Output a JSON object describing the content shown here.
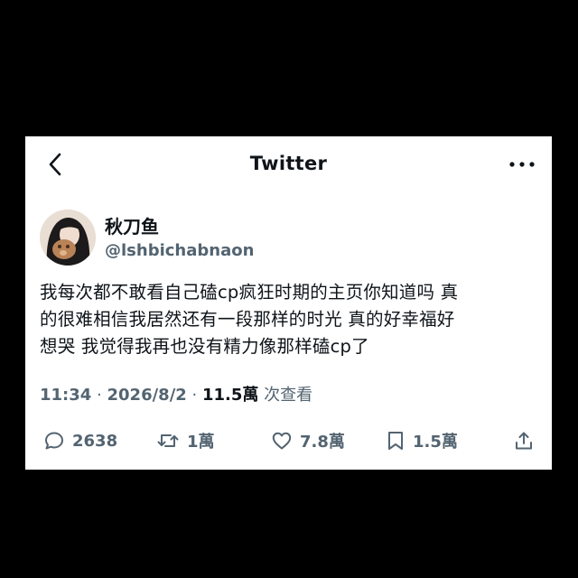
{
  "header": {
    "title": "Twitter"
  },
  "author": {
    "display_name": "秋刀鱼",
    "handle": "@lshbichabnaon"
  },
  "tweet": {
    "lines": [
      "我每次都不敢看自己磕cp疯狂时期的主页你知道吗 真",
      "的很难相信我居然还有一段那样的时光 真的好幸福好",
      "想哭 我觉得我再也没有精力像那样磕cp了"
    ]
  },
  "meta": {
    "time": "11:34",
    "separator": "·",
    "date": "2026/8/2",
    "views_count": "11.5萬",
    "views_label": "次查看"
  },
  "actions": {
    "replies": "2638",
    "retweets": "1萬",
    "likes": "7.8萬",
    "bookmarks": "1.5萬"
  },
  "colors": {
    "background": "#000000",
    "card": "#ffffff",
    "text": "#0f1419",
    "secondary": "#536471"
  }
}
